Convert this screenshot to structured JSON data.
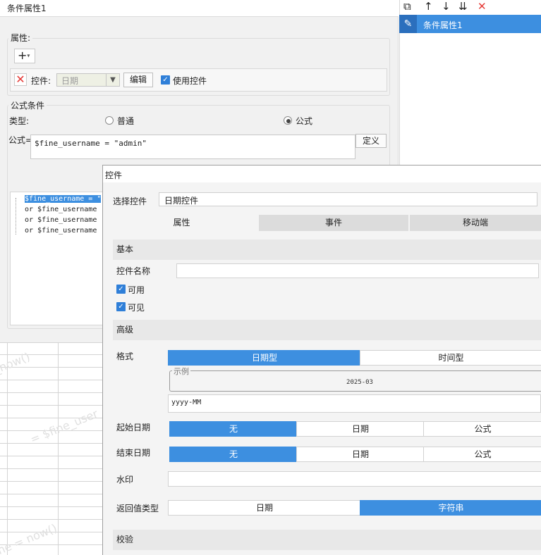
{
  "base_window": {
    "title": "条件属性1",
    "properties_group": "属性:",
    "add_label": "+",
    "control_label": "控件:",
    "control_select_value": "日期",
    "edit_button": "编辑",
    "use_control_label": "使用控件",
    "formula_group": "公式条件",
    "type_label": "类型:",
    "radio_normal": "普通",
    "radio_formula": "公式",
    "formula_label": "公式=",
    "formula_value": "$fine_username = \"admin\"",
    "define_button": "定义",
    "tree_lines": [
      "$fine_username = \"",
      "or  $fine_username",
      "or  $fine_username",
      "or  $fine_username"
    ]
  },
  "right_panel": {
    "item_label": "条件属性1",
    "tools": [
      "copy-icon",
      "arrow-up-icon",
      "arrow-down-icon",
      "move-bottom-icon",
      "delete-icon"
    ]
  },
  "sheet_watermarks": [
    "_now()",
    "= $fine_user",
    "ne = now()"
  ],
  "dialog": {
    "title": "控件",
    "select_control_label": "选择控件",
    "select_control_value": "日期控件",
    "tabs": [
      "属性",
      "事件",
      "移动端"
    ],
    "section_basic": "基本",
    "control_name_label": "控件名称",
    "control_name_value": "",
    "enabled_label": "可用",
    "visible_label": "可见",
    "section_advanced": "高级",
    "format_label": "格式",
    "format_options": [
      "日期型",
      "时间型"
    ],
    "example_legend": "示例",
    "example_value": "2025-03",
    "format_pattern": "yyyy-MM",
    "start_date_label": "起始日期",
    "end_date_label": "结束日期",
    "date_options": [
      "无",
      "日期",
      "公式"
    ],
    "watermark_label": "水印",
    "return_type_label": "返回值类型",
    "return_options": [
      "日期",
      "字符串"
    ],
    "section_validate": "校验"
  },
  "colors": {
    "accent": "#3d8fe0",
    "delete_red": "#e53935"
  }
}
